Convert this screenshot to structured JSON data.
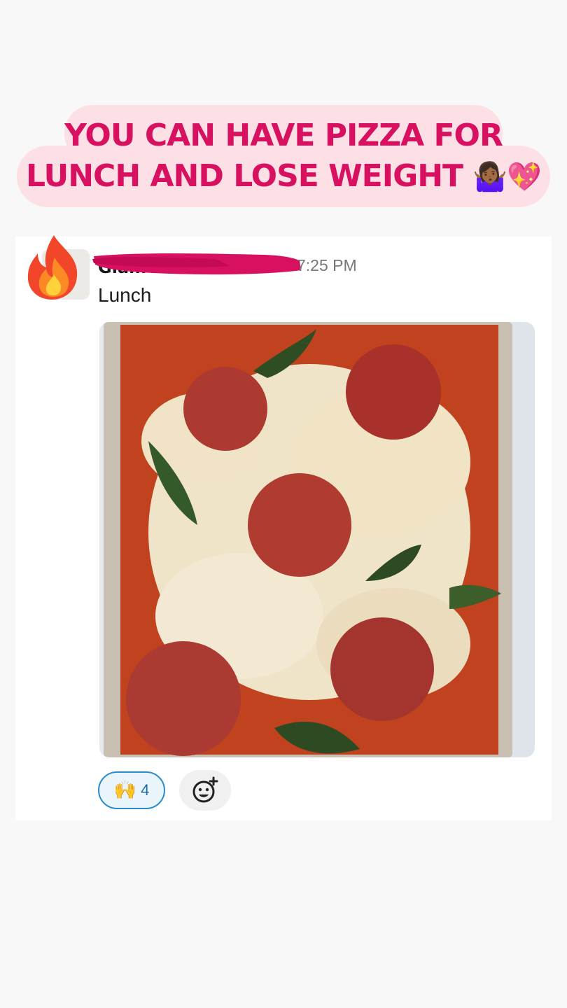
{
  "headline": {
    "line1": "YOU CAN HAVE PIZZA FOR",
    "line2": "LUNCH AND LOSE WEIGHT",
    "emojis": "🤷🏾‍♀️💖"
  },
  "message": {
    "avatar_icon": "fire-icon",
    "sender": "Glam",
    "time": "7:25 PM",
    "text": "Lunch",
    "attachment": "pizza-photo",
    "reaction": {
      "emoji": "🙌",
      "count": "4"
    },
    "add_reaction_icon": "add-reaction-icon"
  },
  "colors": {
    "headline_text": "#d7105f",
    "headline_bubble": "#fde0e6",
    "redaction": "#d7105f",
    "reaction_border": "#2a8cc8"
  }
}
